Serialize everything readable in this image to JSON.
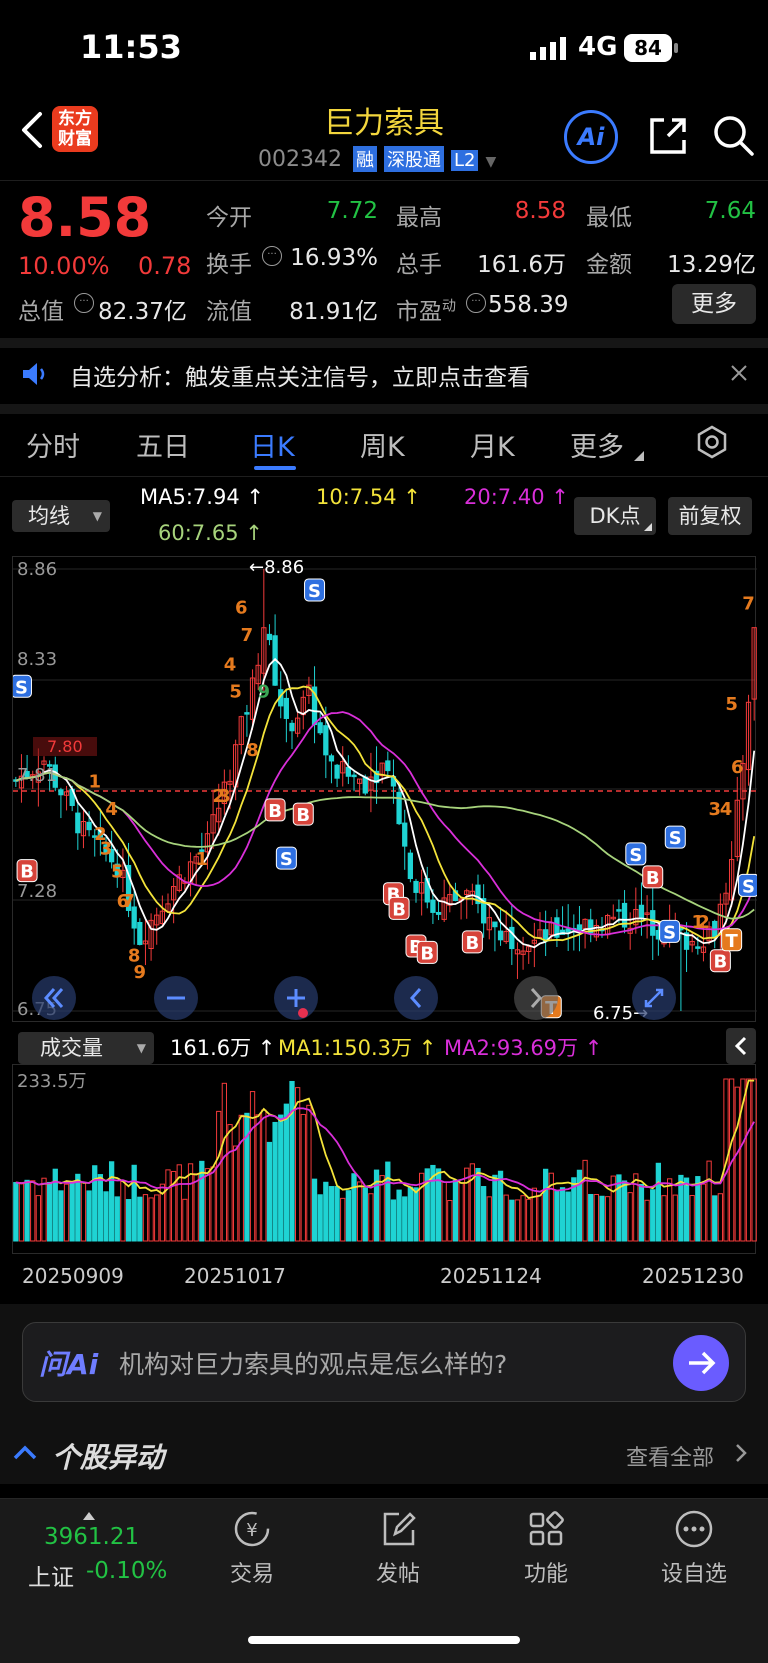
{
  "status_bar": {
    "time": "11:53",
    "network": "4G",
    "battery": "84"
  },
  "header": {
    "logo_line1": "东方",
    "logo_line2": "财富",
    "stock_name": "巨力索具",
    "stock_code": "002342",
    "badges": [
      "融",
      "深股通",
      "L2"
    ],
    "ai_label": "Ai"
  },
  "quote": {
    "price": "8.58",
    "change_pct": "10.00%",
    "change": "0.78",
    "open_label": "今开",
    "open": "7.72",
    "high_label": "最高",
    "high": "8.58",
    "low_label": "最低",
    "low": "7.64",
    "turnover_label": "换手",
    "turnover": "16.93%",
    "volume_label": "总手",
    "volume": "161.6万",
    "amount_label": "金额",
    "amount": "13.29亿",
    "mktcap_label": "总值",
    "mktcap": "82.37亿",
    "float_label": "流值",
    "float_cap": "81.91亿",
    "pe_label": "市盈",
    "pe_sup": "动",
    "pe": "558.39",
    "more_button": "更多"
  },
  "notice": {
    "text": "自选分析：触发重点关注信号，立即点击查看"
  },
  "tabs": [
    "分时",
    "五日",
    "日K",
    "周K",
    "月K",
    "更多"
  ],
  "active_tab_index": 2,
  "indicator_bar": {
    "selector": "均线",
    "ma5": "MA5:7.94 ↑",
    "ma10": "10:7.54 ↑",
    "ma20": "20:7.40 ↑",
    "ma60": "60:7.65 ↑",
    "dk_button": "DK点",
    "fq_button": "前复权"
  },
  "colors": {
    "up": "#f23a3a",
    "down": "#1fd3d3",
    "ma5": "#ffffff",
    "ma10": "#f3e33a",
    "ma20": "#d92fd9",
    "ma60": "#a7d37c",
    "accent": "#3b7bff"
  },
  "kline": {
    "y_labels": [
      "8.86",
      "8.33",
      "7.81",
      "7.28",
      "6.75"
    ],
    "hi_label": "8.86",
    "lo_label": "6.75",
    "ref_price_label": "7.80",
    "markers": [
      {
        "t": "S",
        "i": 1,
        "p": 8.3,
        "c": "blue"
      },
      {
        "t": "B",
        "i": 2,
        "p": 7.42,
        "c": "red"
      },
      {
        "t": "1",
        "i": 14,
        "p": 7.85,
        "c": "orange"
      },
      {
        "t": "2",
        "i": 15,
        "p": 7.6,
        "c": "orange"
      },
      {
        "t": "3",
        "i": 16,
        "p": 7.53,
        "c": "orange"
      },
      {
        "t": "4",
        "i": 17,
        "p": 7.72,
        "c": "orange"
      },
      {
        "t": "5",
        "i": 18,
        "p": 7.42,
        "c": "orange"
      },
      {
        "t": "6",
        "i": 19,
        "p": 7.28,
        "c": "orange"
      },
      {
        "t": "7",
        "i": 20,
        "p": 7.28,
        "c": "orange"
      },
      {
        "t": "8",
        "i": 21,
        "p": 7.02,
        "c": "orange"
      },
      {
        "t": "9",
        "i": 22,
        "p": 6.94,
        "c": "orange"
      },
      {
        "t": "1",
        "i": 33,
        "p": 7.48,
        "c": "orange"
      },
      {
        "t": "2",
        "i": 36,
        "p": 7.78,
        "c": "orange"
      },
      {
        "t": "3",
        "i": 37,
        "p": 7.78,
        "c": "orange"
      },
      {
        "t": "4",
        "i": 38,
        "p": 8.41,
        "c": "orange"
      },
      {
        "t": "5",
        "i": 39,
        "p": 8.28,
        "c": "orange"
      },
      {
        "t": "6",
        "i": 40,
        "p": 8.68,
        "c": "orange"
      },
      {
        "t": "7",
        "i": 41,
        "p": 8.55,
        "c": "orange"
      },
      {
        "t": "8",
        "i": 42,
        "p": 8.0,
        "c": "orange"
      },
      {
        "t": "9",
        "i": 44,
        "p": 8.28,
        "c": "green"
      },
      {
        "t": "B",
        "i": 46,
        "p": 7.71,
        "c": "red"
      },
      {
        "t": "S",
        "i": 48,
        "p": 7.48,
        "c": "blue"
      },
      {
        "t": "B",
        "i": 51,
        "p": 7.69,
        "c": "red"
      },
      {
        "t": "S",
        "i": 53,
        "p": 8.76,
        "c": "blue"
      },
      {
        "t": "B",
        "i": 67,
        "p": 7.31,
        "c": "red"
      },
      {
        "t": "B",
        "i": 68,
        "p": 7.24,
        "c": "red"
      },
      {
        "t": "B",
        "i": 71,
        "p": 7.06,
        "c": "red"
      },
      {
        "t": "B",
        "i": 73,
        "p": 7.03,
        "c": "red"
      },
      {
        "t": "B",
        "i": 81,
        "p": 7.08,
        "c": "red"
      },
      {
        "t": "T",
        "i": 95,
        "p": 6.77,
        "c": "orange"
      },
      {
        "t": "S",
        "i": 110,
        "p": 7.5,
        "c": "blue"
      },
      {
        "t": "B",
        "i": 113,
        "p": 7.39,
        "c": "red"
      },
      {
        "t": "S",
        "i": 116,
        "p": 7.13,
        "c": "blue"
      },
      {
        "t": "S",
        "i": 117,
        "p": 7.58,
        "c": "blue"
      },
      {
        "t": "1",
        "i": 121,
        "p": 7.18,
        "c": "orange"
      },
      {
        "t": "2",
        "i": 122,
        "p": 7.18,
        "c": "orange"
      },
      {
        "t": "B",
        "i": 125,
        "p": 6.99,
        "c": "red"
      },
      {
        "t": "T",
        "i": 127,
        "p": 7.09,
        "c": "orange"
      },
      {
        "t": "3",
        "i": 124,
        "p": 7.72,
        "c": "orange"
      },
      {
        "t": "4",
        "i": 126,
        "p": 7.72,
        "c": "orange"
      },
      {
        "t": "S",
        "i": 130,
        "p": 7.35,
        "c": "blue"
      },
      {
        "t": "5",
        "i": 127,
        "p": 8.22,
        "c": "orange"
      },
      {
        "t": "6",
        "i": 128,
        "p": 7.92,
        "c": "orange"
      },
      {
        "t": "7",
        "i": 130,
        "p": 8.7,
        "c": "orange"
      }
    ]
  },
  "volume": {
    "selector": "成交量",
    "vol": "161.6万 ↑",
    "ma1": "MA1:150.3万 ↑",
    "ma2": "MA2:93.69万 ↑",
    "max_label": "233.5万",
    "dates": [
      "20250909",
      "20251017",
      "20251124",
      "20251230"
    ]
  },
  "chart_data": {
    "type": "candlestick",
    "y_range": [
      6.75,
      8.86
    ],
    "volume_max": "233.5万",
    "series": [
      {
        "name": "MA5",
        "last": "7.94"
      },
      {
        "name": "10",
        "last": "7.54"
      },
      {
        "name": "20",
        "last": "7.40"
      },
      {
        "name": "60",
        "last": "7.65"
      }
    ],
    "x_labels": [
      "20250909",
      "20251017",
      "20251124",
      "20251230"
    ]
  },
  "ask_ai": {
    "brand": "问Ai",
    "placeholder": "机构对巨力索具的观点是怎么样的?"
  },
  "movers": {
    "title": "个股异动",
    "view_all": "查看全部"
  },
  "bottom_nav": {
    "index_value": "3961.21",
    "index_name": "上证",
    "index_change": "-0.10%",
    "items": [
      "交易",
      "发帖",
      "功能",
      "设自选"
    ]
  }
}
